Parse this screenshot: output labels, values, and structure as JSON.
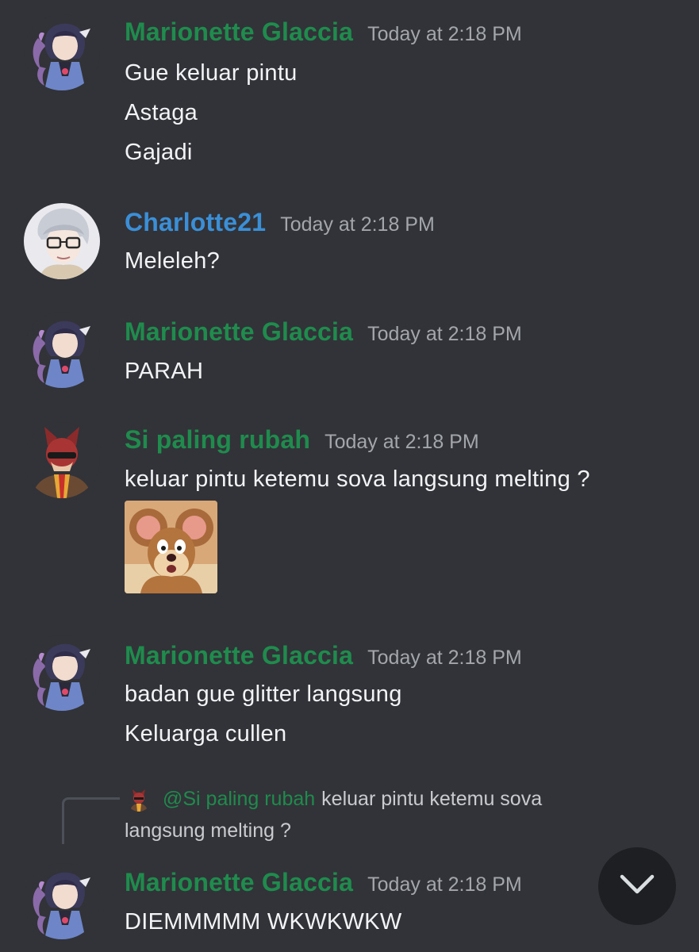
{
  "messages": [
    {
      "username": "Marionette Glaccia",
      "timestamp": "Today at 2:18 PM",
      "avatar": "anime-girl-avatar",
      "lines": [
        "Gue keluar pintu",
        "Astaga",
        "Gajadi"
      ]
    },
    {
      "username": "Charlotte21",
      "timestamp": "Today at 2:18 PM",
      "avatar": "glasses-boy-avatar",
      "lines": [
        "Meleleh?"
      ]
    },
    {
      "username": "Marionette Glaccia",
      "timestamp": "Today at 2:18 PM",
      "avatar": "anime-girl-avatar",
      "lines": [
        "PARAH"
      ]
    },
    {
      "username": "Si paling rubah",
      "timestamp": "Today at 2:18 PM",
      "avatar": "fox-mask-avatar",
      "lines": [
        "keluar pintu ketemu sova langsung melting ?"
      ],
      "sticker": "jerry-mouse-sticker"
    },
    {
      "username": "Marionette Glaccia",
      "timestamp": "Today at 2:18 PM",
      "avatar": "anime-girl-avatar",
      "lines": [
        "badan gue glitter langsung",
        "Keluarga cullen"
      ]
    },
    {
      "username": "Marionette Glaccia",
      "timestamp": "Today at 2:18 PM",
      "avatar": "anime-girl-avatar",
      "lines": [
        "DIEMMMMM WKWKWKW"
      ],
      "reply": {
        "mention": "@Si paling rubah",
        "text_line1": "keluar pintu ketemu sova",
        "text_line2": "langsung melting ?"
      }
    }
  ],
  "scroll_button": {
    "icon": "chevron-down-icon"
  },
  "colors": {
    "background": "#313338",
    "username_green": "#1f8b4c",
    "username_blue": "#3b8fd6",
    "timestamp": "#a3a6aa",
    "text": "#f2f3f5"
  }
}
